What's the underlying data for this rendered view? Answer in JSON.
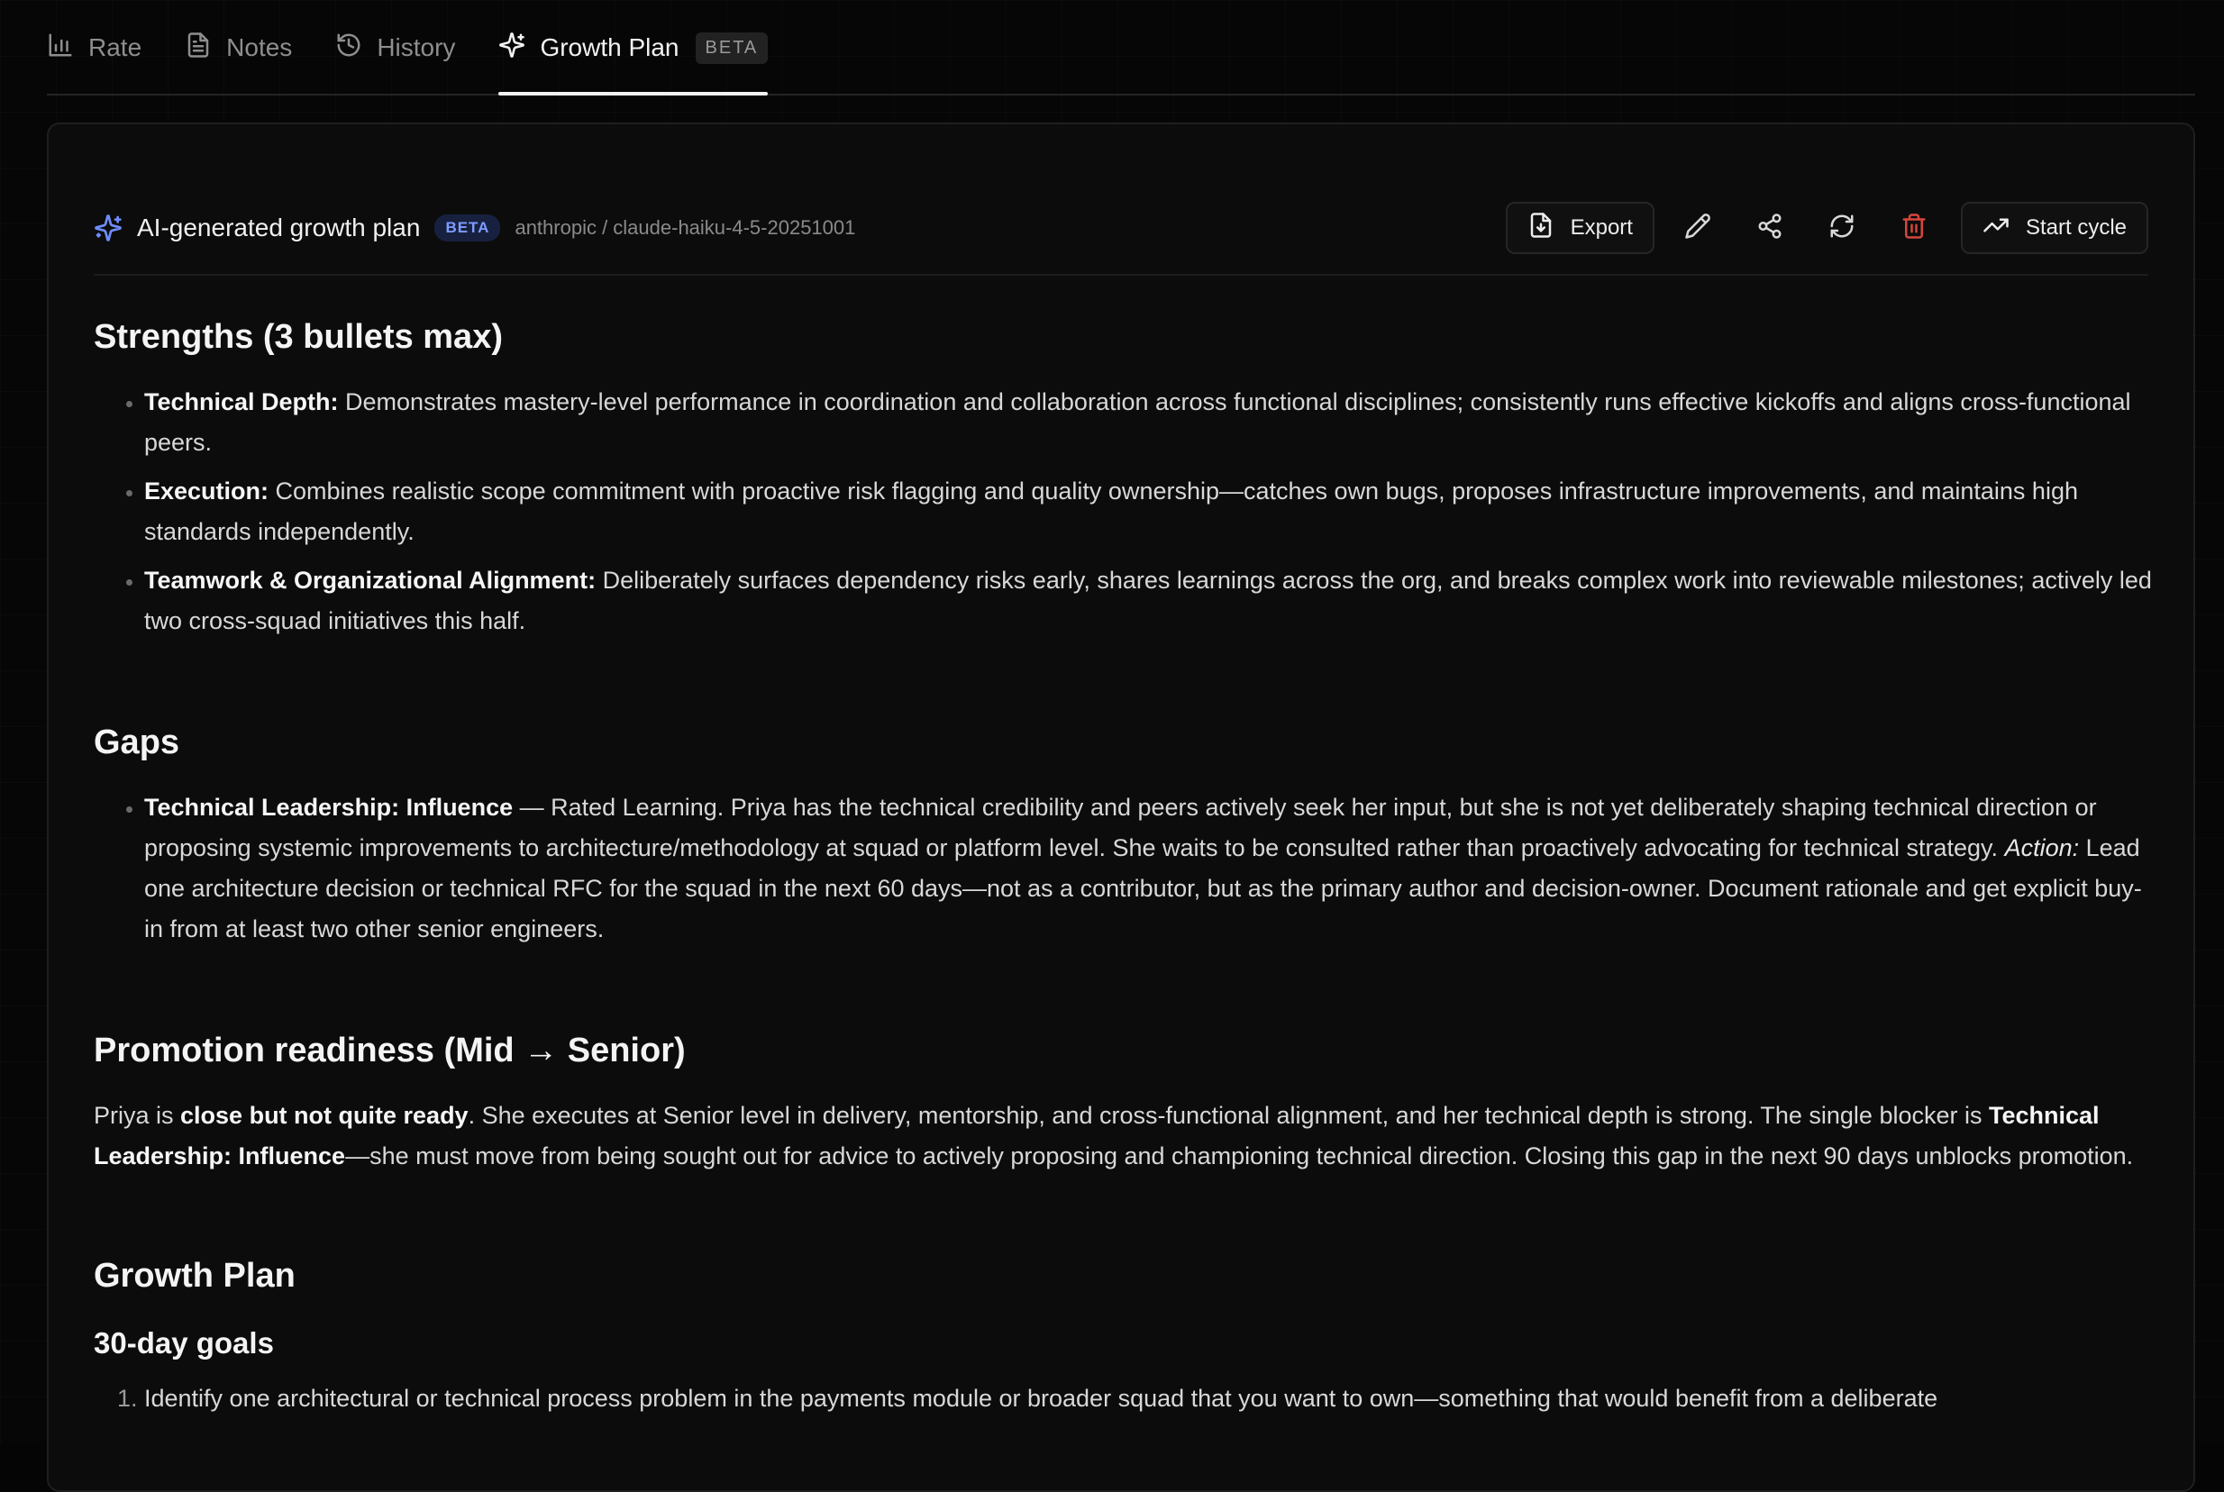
{
  "tabs": [
    {
      "label": "Rate",
      "icon": "bar-chart-icon"
    },
    {
      "label": "Notes",
      "icon": "document-icon"
    },
    {
      "label": "History",
      "icon": "history-icon"
    },
    {
      "label": "Growth Plan",
      "icon": "sparkles-icon",
      "badge": "BETA",
      "active": true
    }
  ],
  "header": {
    "title": "AI-generated growth plan",
    "badge": "BETA",
    "model": "anthropic / claude-haiku-4-5-20251001",
    "export_label": "Export",
    "start_cycle_label": "Start cycle"
  },
  "colors": {
    "accent": "#6f8dff",
    "danger": "#d6463d",
    "background": "#060606",
    "card": "#0c0c0c"
  },
  "strengths": {
    "heading": "Strengths (3 bullets max)",
    "items": [
      {
        "label": "Technical Depth:",
        "text": " Demonstrates mastery-level performance in coordination and collaboration across functional disciplines; consistently runs effective kickoffs and aligns cross-functional peers."
      },
      {
        "label": "Execution:",
        "text": " Combines realistic scope commitment with proactive risk flagging and quality ownership—catches own bugs, proposes infrastructure improvements, and maintains high standards independently."
      },
      {
        "label": "Teamwork & Organizational Alignment:",
        "text": " Deliberately surfaces dependency risks early, shares learnings across the org, and breaks complex work into reviewable milestones; actively led two cross-squad initiatives this half."
      }
    ]
  },
  "gaps": {
    "heading": "Gaps",
    "items": [
      {
        "label": "Technical Leadership: Influence",
        "text": " — Rated Learning. Priya has the technical credibility and peers actively seek her input, but she is not yet deliberately shaping technical direction or proposing systemic improvements to architecture/methodology at squad or platform level. She waits to be consulted rather than proactively advocating for technical strategy. ",
        "action_label": "Action:",
        "action_text": " Lead one architecture decision or technical RFC for the squad in the next 60 days—not as a contributor, but as the primary author and decision-owner. Document rationale and get explicit buy-in from at least two other senior engineers."
      }
    ]
  },
  "promotion": {
    "heading": "Promotion readiness (Mid → Senior)",
    "t1": "Priya is ",
    "b1": "close but not quite ready",
    "t2": ". She executes at Senior level in delivery, mentorship, and cross-functional alignment, and her technical depth is strong. The single blocker is ",
    "b2": "Technical Leadership: Influence",
    "t3": "—she must move from being sought out for advice to actively proposing and championing technical direction. Closing this gap in the next 90 days unblocks promotion."
  },
  "growth_plan": {
    "heading": "Growth Plan",
    "subheading": "30-day goals",
    "goals": [
      "Identify one architectural or technical process problem in the payments module or broader squad that you want to own—something that would benefit from a deliberate"
    ]
  }
}
